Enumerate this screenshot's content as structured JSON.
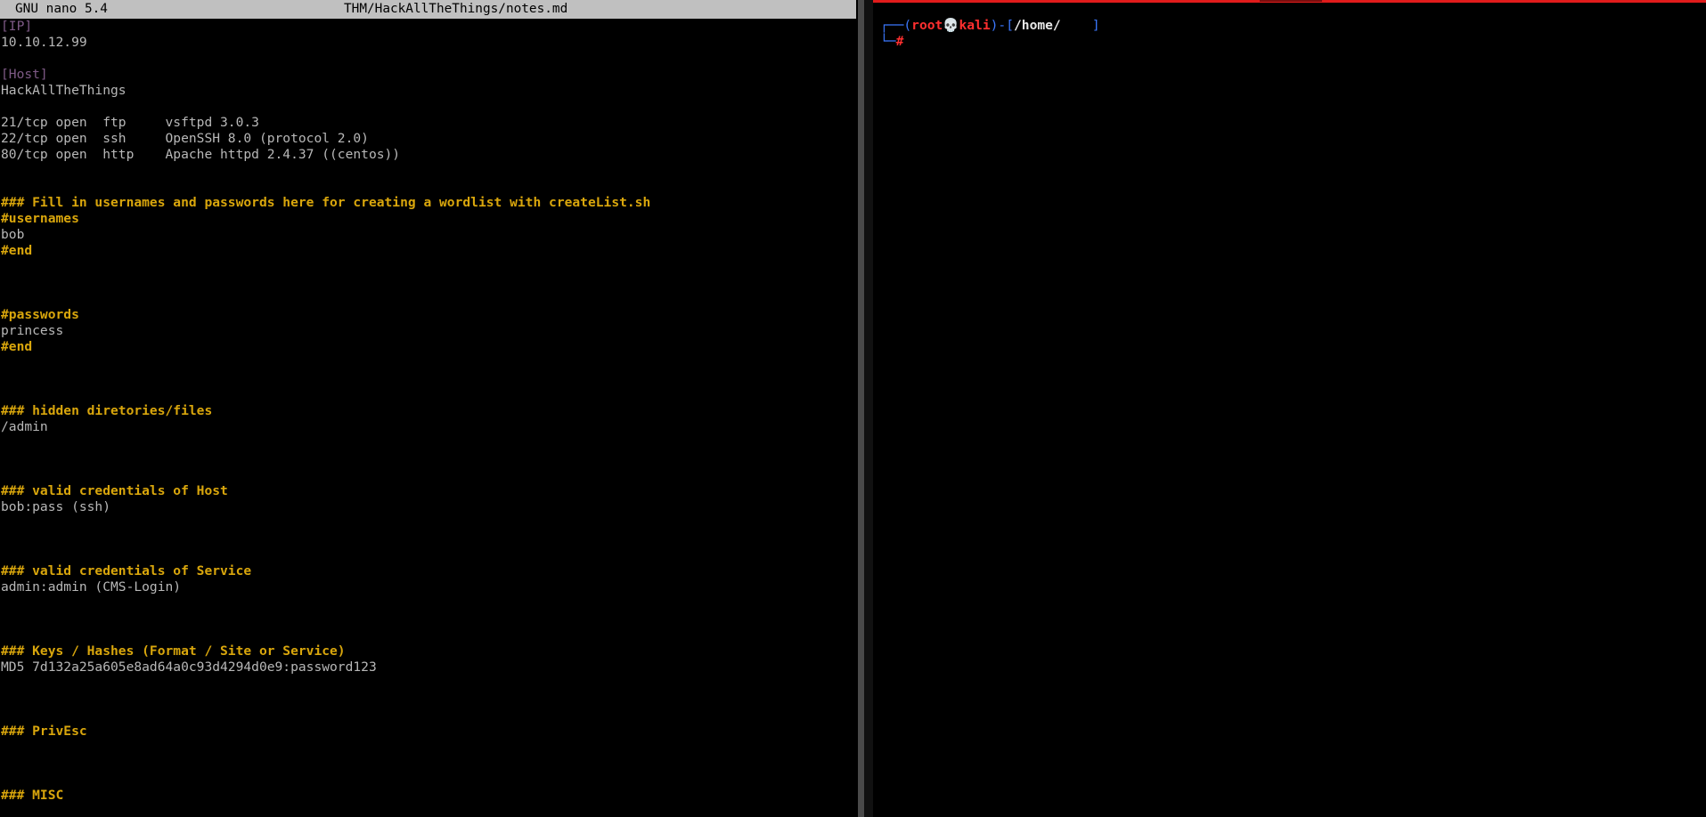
{
  "nano": {
    "version": "GNU nano 5.4",
    "filename": "THM/HackAllTheThings/notes.md",
    "lines": [
      {
        "text": "[IP]",
        "style": "tag"
      },
      {
        "text": "10.10.12.99",
        "style": "plain"
      },
      {
        "text": "",
        "style": "plain"
      },
      {
        "text": "[Host]",
        "style": "tag"
      },
      {
        "text": "HackAllTheThings",
        "style": "plain"
      },
      {
        "text": "",
        "style": "plain"
      },
      {
        "text": "21/tcp open  ftp     vsftpd 3.0.3",
        "style": "plain"
      },
      {
        "text": "22/tcp open  ssh     OpenSSH 8.0 (protocol 2.0)",
        "style": "plain"
      },
      {
        "text": "80/tcp open  http    Apache httpd 2.4.37 ((centos))",
        "style": "plain"
      },
      {
        "text": "",
        "style": "plain"
      },
      {
        "text": "",
        "style": "plain"
      },
      {
        "text": "### Fill in usernames and passwords here for creating a wordlist with createList.sh",
        "style": "heading"
      },
      {
        "text": "#usernames",
        "style": "heading"
      },
      {
        "text": "bob",
        "style": "plain"
      },
      {
        "text": "#end",
        "style": "heading"
      },
      {
        "text": "",
        "style": "plain"
      },
      {
        "text": "",
        "style": "plain"
      },
      {
        "text": "",
        "style": "plain"
      },
      {
        "text": "#passwords",
        "style": "heading"
      },
      {
        "text": "princess",
        "style": "plain"
      },
      {
        "text": "#end",
        "style": "heading"
      },
      {
        "text": "",
        "style": "plain"
      },
      {
        "text": "",
        "style": "plain"
      },
      {
        "text": "",
        "style": "plain"
      },
      {
        "text": "### hidden diretories/files",
        "style": "heading"
      },
      {
        "text": "/admin",
        "style": "plain"
      },
      {
        "text": "",
        "style": "plain"
      },
      {
        "text": "",
        "style": "plain"
      },
      {
        "text": "",
        "style": "plain"
      },
      {
        "text": "### valid credentials of Host",
        "style": "heading"
      },
      {
        "text": "bob:pass (ssh)",
        "style": "plain"
      },
      {
        "text": "",
        "style": "plain"
      },
      {
        "text": "",
        "style": "plain"
      },
      {
        "text": "",
        "style": "plain"
      },
      {
        "text": "### valid credentials of Service",
        "style": "heading"
      },
      {
        "text": "admin:admin (CMS-Login)",
        "style": "plain"
      },
      {
        "text": "",
        "style": "plain"
      },
      {
        "text": "",
        "style": "plain"
      },
      {
        "text": "",
        "style": "plain"
      },
      {
        "text": "### Keys / Hashes (Format / Site or Service)",
        "style": "heading"
      },
      {
        "text": "MD5 7d132a25a605e8ad64a0c93d4294d0e9:password123",
        "style": "plain"
      },
      {
        "text": "",
        "style": "plain"
      },
      {
        "text": "",
        "style": "plain"
      },
      {
        "text": "",
        "style": "plain"
      },
      {
        "text": "### PrivEsc",
        "style": "heading"
      },
      {
        "text": "",
        "style": "plain"
      },
      {
        "text": "",
        "style": "plain"
      },
      {
        "text": "",
        "style": "plain"
      },
      {
        "text": "### MISC",
        "style": "heading"
      }
    ]
  },
  "terminal": {
    "corner_top": "┌──",
    "paren_open": "(",
    "user": "root",
    "skull": "💀",
    "host": "kali",
    "paren_close": ")-[",
    "path": "/home/",
    "path_gap": "    ",
    "bracket_close": "]",
    "corner_bottom": "└─",
    "prompt_symbol": "#"
  },
  "colors": {
    "heading": "#d9a60c",
    "tag": "#7e5a86",
    "text": "#b8b8b8",
    "terminal_accent": "#3b78ff",
    "terminal_user": "#ff2f2f",
    "topbar": "#e01b1b"
  }
}
